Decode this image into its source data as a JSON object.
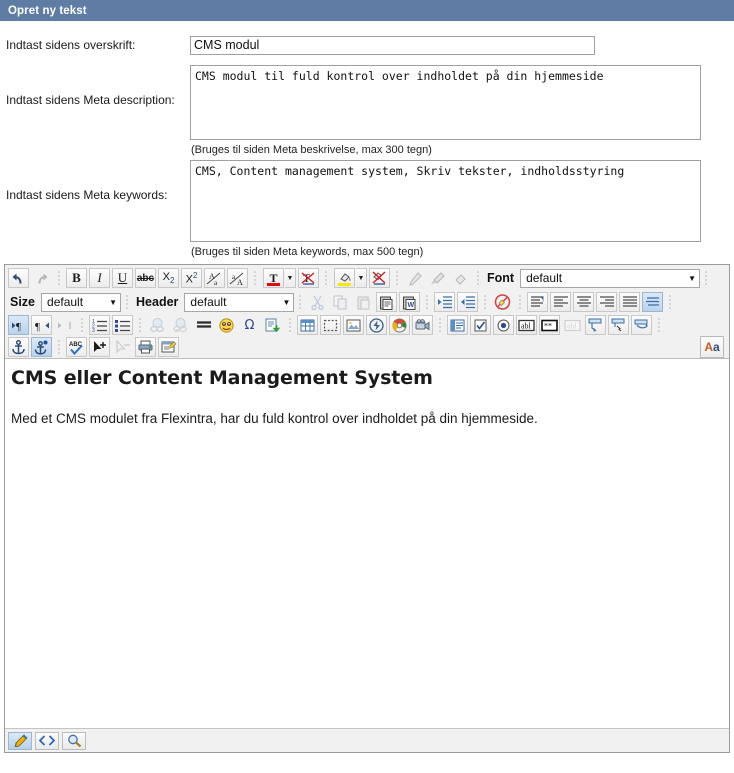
{
  "window": {
    "title": "Opret ny tekst"
  },
  "form": {
    "heading_label": "Indtast sidens overskrift:",
    "heading_value": "CMS modul",
    "description_label": "Indtast sidens Meta description:",
    "description_value": "CMS modul til fuld kontrol over indholdet på din hjemmeside",
    "description_hint": "(Bruges til siden Meta beskrivelse, max 300 tegn)",
    "keywords_label": "Indtast sidens Meta keywords:",
    "keywords_value": "CMS, Content management system, Skriv tekster, indholdsstyring",
    "keywords_hint": "(Bruges til siden Meta keywords, max 500 tegn)"
  },
  "editor": {
    "toolbar": {
      "font_label": "Font",
      "font_value": "default",
      "size_label": "Size",
      "size_value": "default",
      "header_label": "Header",
      "header_value": "default",
      "case_button": {
        "a_upper": "A",
        "a_lower": "a"
      },
      "row1_icons": [
        "undo-icon",
        "redo-icon",
        "bold-icon",
        "italic-icon",
        "underline-icon",
        "strikethrough-icon",
        "subscript-icon",
        "superscript-icon",
        "increase-font-size-icon",
        "decrease-font-size-icon",
        "text-color-icon",
        "text-color-dropdown-icon",
        "remove-text-color-icon",
        "highlight-color-icon",
        "highlight-color-dropdown-icon",
        "remove-highlight-icon",
        "format-painter-pick-icon",
        "format-painter-apply-icon",
        "clear-formatting-icon"
      ],
      "row2_icons": [
        "cut-icon",
        "copy-icon",
        "paste-icon",
        "paste-text-icon",
        "paste-word-icon",
        "increase-indent-icon",
        "decrease-indent-icon",
        "remove-format-icon",
        "align-justify-block-icon",
        "align-left-icon",
        "align-center-icon",
        "align-right-icon",
        "align-justify-icon",
        "align-distribute-icon"
      ],
      "row3_icons": [
        "ltr-direction-icon",
        "rtl-direction-icon",
        "line-break-icon",
        "ordered-list-icon",
        "unordered-list-icon",
        "insert-link-icon",
        "remove-link-icon",
        "horizontal-rule-icon",
        "emoticon-icon",
        "special-character-icon",
        "insert-document-icon",
        "insert-table-icon",
        "insert-div-icon",
        "insert-image-icon",
        "insert-flash-icon",
        "insert-media-icon",
        "insert-video-icon",
        "insert-form-icon",
        "insert-checkbox-icon",
        "insert-radio-icon",
        "insert-textfield-icon",
        "insert-password-icon",
        "insert-textarea-icon",
        "insert-select-icon",
        "insert-button-icon",
        "insert-hidden-field-icon"
      ],
      "row4_icons": [
        "anchor-icon",
        "anchor-add-icon",
        "spellcheck-icon",
        "select-element-icon",
        "select-parent-icon",
        "print-icon",
        "page-properties-icon"
      ]
    },
    "content": {
      "heading": "CMS eller Content Management System",
      "paragraph": "Med et CMS modulet fra Flexintra, har du fuld kontrol over indholdet på din hjemmeside."
    },
    "statusbar_icons": [
      "design-mode-icon",
      "source-mode-icon",
      "preview-mode-icon"
    ]
  },
  "colors": {
    "titlebar": "#5e7ca4",
    "text_color_swatch": "#e00d0d",
    "highlight_color_swatch": "#ffe800",
    "toolbar_bg": "#f1f1f1",
    "active_button": "#b9d3ee"
  }
}
